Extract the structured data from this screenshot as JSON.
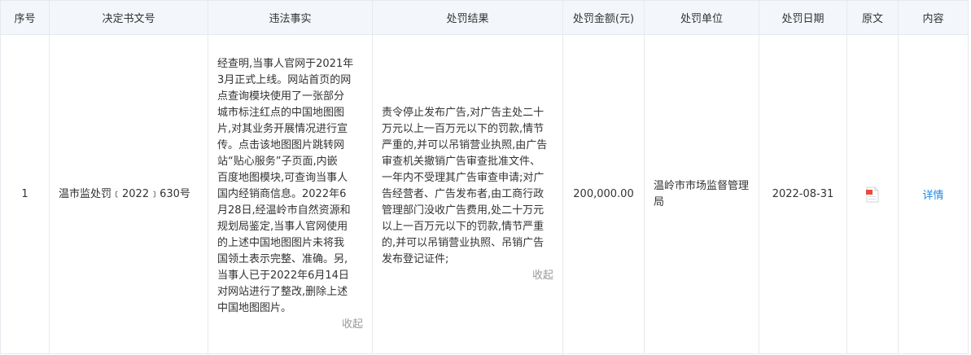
{
  "table": {
    "headers": [
      "序号",
      "决定书文号",
      "违法事实",
      "处罚结果",
      "处罚金额(元)",
      "处罚单位",
      "处罚日期",
      "原文",
      "内容"
    ],
    "row": {
      "index": "1",
      "doc_no": "温市监处罚﹝2022﹞630号",
      "facts_lines": [
        "经查明,当事人官网于2021年",
        "3月正式上线。网站首页的网",
        "点查询模块使用了一张部分",
        "城市标注红点的中国地图图",
        "片,对其业务开展情况进行宣",
        "传。点击该地图图片跳转网",
        "站“贴心服务”子页面,内嵌",
        "百度地图模块,可查询当事人",
        "国内经销商信息。2022年6",
        "月28日,经温岭市自然资源和",
        "规划局鉴定,当事人官网使用",
        "的上述中国地图图片未将我",
        "国领土表示完整、准确。另,",
        "当事人已于2022年6月14日",
        "对网站进行了整改,删除上述",
        "中国地图图片。"
      ],
      "result_lines": [
        "责令停止发布广告,对广告主处二十",
        "万元以上一百万元以下的罚款,情节",
        "严重的,并可以吊销营业执照,由广告",
        "审查机关撤销广告审查批准文件、",
        "一年内不受理其广告审查申请;对广",
        "告经营者、广告发布者,由工商行政",
        "管理部门没收广告费用,处二十万元",
        "以上一百万元以下的罚款,情节严重",
        "的,并可以吊销营业执照、吊销广告",
        "发布登记证件;"
      ],
      "collapse_label": "收起",
      "amount": "200,000.00",
      "unit_lines": [
        "温岭市市场监督管理",
        "局"
      ],
      "date": "2022-08-31",
      "original_icon": "pdf-file-icon",
      "detail_label": "详情"
    }
  },
  "colors": {
    "header_bg": "#f3f6fa",
    "border": "#e6e9ee",
    "link": "#1e88e5",
    "muted": "#999999",
    "pdf_red": "#e84c3d"
  }
}
